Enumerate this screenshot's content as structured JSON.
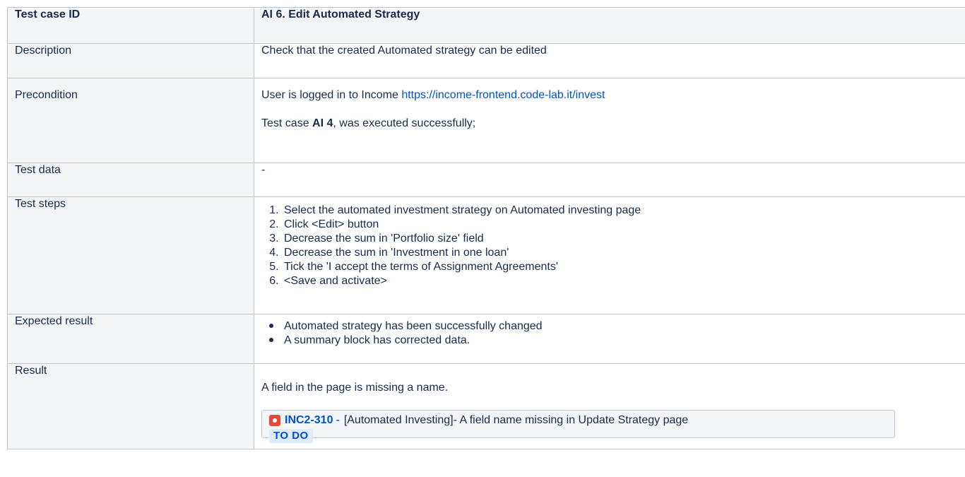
{
  "table": {
    "header": {
      "label": "Test case ID",
      "value": "AI 6. Edit Automated Strategy"
    },
    "description": {
      "label": "Description",
      "value": "Check that the created Automated strategy can be edited"
    },
    "precondition": {
      "label": "Precondition",
      "line1_prefix": "User is logged in to Income ",
      "line1_link": "https://income-frontend.code-lab.it/invest",
      "line2_prefix": "Test case ",
      "line2_bold": "AI 4",
      "line2_suffix": ", was executed successfully;"
    },
    "test_data": {
      "label": "Test data",
      "value": "-"
    },
    "test_steps": {
      "label": "Test steps",
      "items": [
        "Select the automated investment strategy on Automated investing page",
        "Click <Edit> button",
        "Decrease the sum in 'Portfolio size' field",
        "Decrease the sum in 'Investment in one loan'",
        "Tick the 'I accept the terms of Assignment Agreements'",
        "<Save and activate>"
      ]
    },
    "expected_result": {
      "label": "Expected result",
      "items": [
        "Automated strategy has been successfully changed",
        "A summary block has corrected data."
      ]
    },
    "result": {
      "label": "Result",
      "text": "A field in the page is missing a name.",
      "issue": {
        "key": "INC2-310",
        "separator": "-",
        "summary": "[Automated Investing]- A field name missing in Update Strategy page",
        "status": "TO DO",
        "icon": "bug-icon"
      }
    }
  },
  "colors": {
    "link": "#0052cc",
    "border": "#c1c7d0",
    "label_bg": "#f4f5f7",
    "bug": "#e5493a",
    "status_bg": "#deebff"
  }
}
